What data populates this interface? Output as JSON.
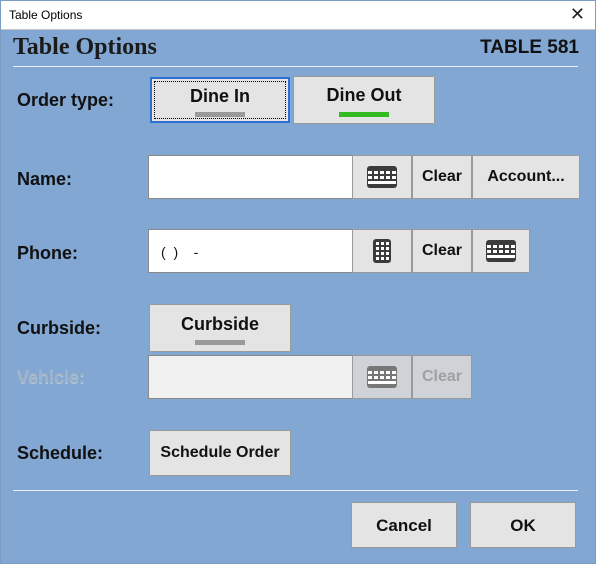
{
  "window": {
    "title": "Table Options",
    "close_glyph": "✕"
  },
  "header": {
    "title": "Table Options",
    "table_label": "TABLE 581"
  },
  "order_type": {
    "label": "Order type:",
    "dine_in": {
      "label": "Dine In",
      "selected": true,
      "indicator": "off"
    },
    "dine_out": {
      "label": "Dine Out",
      "selected": false,
      "indicator": "on"
    }
  },
  "name": {
    "label": "Name:",
    "value": "",
    "keyboard_icon": "keyboard-icon",
    "clear_label": "Clear",
    "account_label": "Account..."
  },
  "phone": {
    "label": "Phone:",
    "value": "(  )    -",
    "keypad_icon": "keypad-icon",
    "clear_label": "Clear",
    "keyboard_icon": "keyboard-icon"
  },
  "curbside": {
    "label": "Curbside:",
    "button_label": "Curbside",
    "indicator": "off"
  },
  "vehicle": {
    "label": "Vehicle:",
    "value": "",
    "enabled": false,
    "keyboard_icon": "keyboard-icon",
    "clear_label": "Clear"
  },
  "schedule": {
    "label": "Schedule:",
    "button_label": "Schedule Order"
  },
  "footer": {
    "cancel_label": "Cancel",
    "ok_label": "OK"
  },
  "colors": {
    "background": "#81a7d2",
    "indicator_on": "#33bb22",
    "indicator_off": "#9a9a9a",
    "selected_border": "#2f6fd1"
  }
}
